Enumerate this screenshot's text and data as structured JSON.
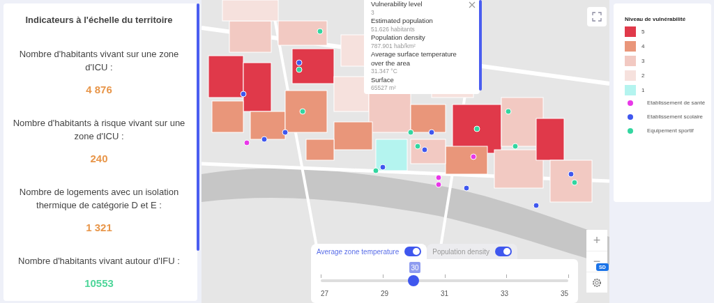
{
  "indicators": {
    "title": "Indicateurs à l'échelle du territoire",
    "items": [
      {
        "label": "Nombre d'habitants vivant sur une zone d'ICU :",
        "value": "4 876",
        "color": "#e8964a"
      },
      {
        "label": "Nombre d'habitants à risque vivant sur une zone d'ICU :",
        "value": "240",
        "color": "#e8964a"
      },
      {
        "label": "Nombre de logements avec un isolation thermique de catégorie D et E :",
        "value": "1 321",
        "color": "#e8964a"
      },
      {
        "label": "Nombre d'habitants vivant autour d'IFU :",
        "value": "10553",
        "color": "#4fd69a"
      }
    ]
  },
  "popup": {
    "fields": [
      {
        "label": "Vulnerability level",
        "value": "3"
      },
      {
        "label": "Estimated population",
        "value": "51.626 habitants"
      },
      {
        "label": "Population density",
        "value": "787.901 hab/km²"
      },
      {
        "label": "Average surface temperature over the area",
        "value": "31.347 °C"
      },
      {
        "label": "Surface",
        "value": "65527 m²"
      }
    ]
  },
  "legend": {
    "title": "Niveau de vulnérabilité",
    "levels": [
      {
        "label": "5",
        "color": "#e0394a"
      },
      {
        "label": "4",
        "color": "#e9967a"
      },
      {
        "label": "3",
        "color": "#f2c9c2"
      },
      {
        "label": "2",
        "color": "#f6e1dd"
      },
      {
        "label": "1",
        "color": "#b4f4ef"
      }
    ],
    "points": [
      {
        "label": "Etablissement de santé",
        "color": "#e838e8"
      },
      {
        "label": "Etablissement scolaire",
        "color": "#3f57ee"
      },
      {
        "label": "Equipement sportif",
        "color": "#33d6a0"
      }
    ]
  },
  "layers": {
    "tabs": [
      {
        "label": "Average zone temperature",
        "selected": true,
        "on": true
      },
      {
        "label": "Population density",
        "selected": false,
        "on": true
      }
    ],
    "slider": {
      "value": "30",
      "level": 0.375,
      "ticks": [
        "27",
        "29",
        "31",
        "33",
        "35"
      ]
    }
  },
  "map_controls": {
    "badge": "SD",
    "zoom_in": "+",
    "zoom_out": "−"
  }
}
